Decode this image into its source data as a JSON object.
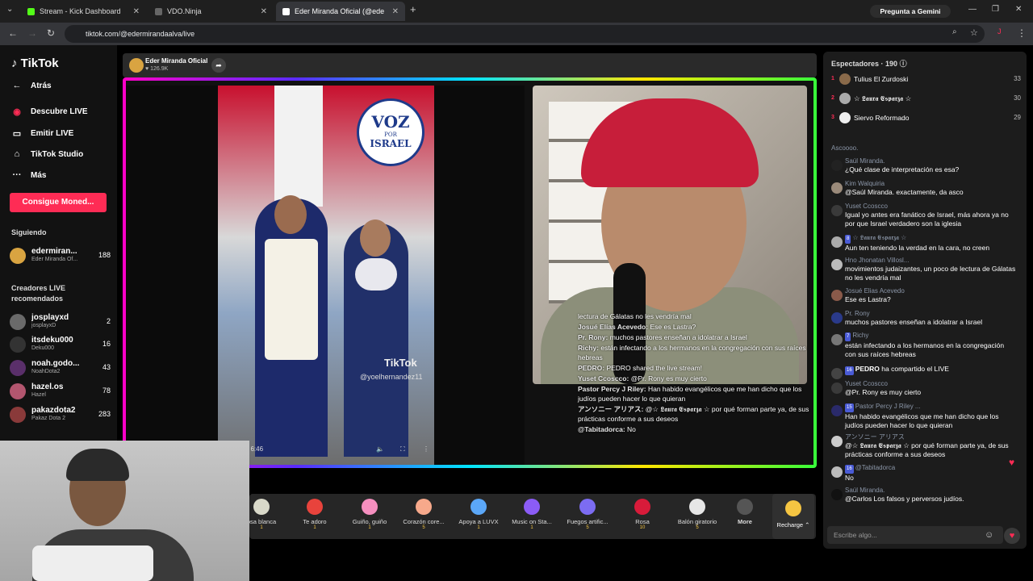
{
  "browser": {
    "tabs": [
      {
        "label": "Stream - Kick Dashboard",
        "color": "#53fc18"
      },
      {
        "label": "VDO.Ninja",
        "color": "#666666"
      },
      {
        "label": "Eder Miranda Oficial (@ede",
        "color": "#111111"
      }
    ],
    "url": "tiktok.com/@edermirandaalva/live",
    "gemini": "Pregunta a Gemini",
    "profile_initial": "J"
  },
  "sidebar": {
    "logo": "TikTok",
    "back": "Atrás",
    "nav": [
      {
        "label": "Descubre LIVE",
        "icon": "live-icon"
      },
      {
        "label": "Emitir LIVE",
        "icon": "camera-icon"
      },
      {
        "label": "TikTok Studio",
        "icon": "home-icon"
      },
      {
        "label": "Más",
        "icon": "more-icon"
      }
    ],
    "coins_button": "Consigue Moned...",
    "following_title": "Siguiendo",
    "following": [
      {
        "name": "edermiran...",
        "sub": "Eder Miranda Of...",
        "count": "188"
      }
    ],
    "recommended_title_1": "Creadores LIVE",
    "recommended_title_2": "recomendados",
    "recommended": [
      {
        "name": "josplayxd",
        "sub": "josplayxD",
        "count": "2"
      },
      {
        "name": "itsdeku000",
        "sub": "Deku000",
        "count": "16"
      },
      {
        "name": "noah.godo...",
        "sub": "NoahDota2",
        "count": "43"
      },
      {
        "name": "hazel.os",
        "sub": "Hazel",
        "count": "78"
      },
      {
        "name": "pakazdota2",
        "sub": "Pakaz Dota 2",
        "count": "283"
      }
    ]
  },
  "host": {
    "name": "Eder Miranda Oficial",
    "likes": "126.9K"
  },
  "video": {
    "logo_top": "VOZ",
    "logo_mid": "POR",
    "logo_bottom": "ISRAEL",
    "watermark": "TikTok",
    "watermark_user": "@yoelhernandez11",
    "time": "/ 6:46"
  },
  "overlay_chat": [
    {
      "user": "",
      "text": "lectura de Gálatas no les vendría mal"
    },
    {
      "user": "Josué Elías Acevedo:",
      "text": "Ese es Lastra?"
    },
    {
      "user": "Pr. Rony:",
      "text": "muchos pastores enseñan a idolatrar a Israel"
    },
    {
      "user": "Richy:",
      "text": "están infectando a los hermanos en la congregación con sus raíces hebreas"
    },
    {
      "user": "PEDRO:",
      "text": "PEDRO shared the live stream!"
    },
    {
      "user": "Yuset Ccoscco:",
      "text": "@Pr. Rony es muy cierto"
    },
    {
      "user": "Pastor Percy J Riley:",
      "text": "Han habido evangélicos que me han dicho que los judíos pueden hacer lo que quieran"
    },
    {
      "user": "アンソニー アリアス:",
      "text": "@☆ 𝕷𝖆𝖚𝖗𝖆 𝕰𝖘𝖕𝖆𝖗𝖟𝖆 ☆ por qué forman parte ya, de sus prácticas conforme a sus deseos"
    },
    {
      "user": "@Tabitadorca:",
      "text": "No"
    }
  ],
  "gifts": [
    {
      "label": "osa blanca",
      "price": "1",
      "color": "#d9d9c9"
    },
    {
      "label": "Te adoro",
      "price": "1",
      "color": "#e8433c"
    },
    {
      "label": "Guiño, guiño",
      "price": "1",
      "color": "#f58fbf"
    },
    {
      "label": "Corazón core...",
      "price": "5",
      "color": "#f7a98b"
    },
    {
      "label": "Apoya a LUVX",
      "price": "1",
      "color": "#5ba7f7"
    },
    {
      "label": "Music on Sta...",
      "price": "1",
      "color": "#8b5cf6"
    },
    {
      "label": "Fuegos artific...",
      "price": "5",
      "color": "#7c6cf2"
    },
    {
      "label": "Rosa",
      "price": "10",
      "color": "#d81b3a"
    },
    {
      "label": "Balón giratorio",
      "price": "5",
      "color": "#e6e6e6"
    },
    {
      "label": "More",
      "price": "",
      "color": "#555555"
    }
  ],
  "recharge": "Recharge",
  "chat": {
    "viewers_title": "Espectadores · 190",
    "top_viewers": [
      {
        "rank": "1",
        "name": "Tulius El Zurdoski",
        "score": "33"
      },
      {
        "rank": "2",
        "name": "☆ 𝕷𝖆𝖚𝖗𝖆 𝕰𝖘𝖕𝖆𝖗𝖟𝖆 ☆",
        "score": "30"
      },
      {
        "rank": "3",
        "name": "Siervo Reformado",
        "score": "29"
      }
    ],
    "messages": [
      {
        "user": "Ascoooo.",
        "text": ""
      },
      {
        "user": "Saúl Miranda.",
        "text": "¿Qué clase de interpretación es esa?"
      },
      {
        "user": "Kim Walquiria",
        "text": "@Saúl Miranda. exactamente, da asco"
      },
      {
        "user": "Yuset Ccoscco",
        "text": "Igual yo antes era fanático de Israel, más ahora ya no por que Israel verdadero son la iglesia"
      },
      {
        "user": "☆ 𝕷𝖆𝖚𝖗𝖆 𝕰𝖘𝖕𝖆𝖗𝖟𝖆 ☆",
        "text": "Aun ten teniendo la verdad en la cara, no creen"
      },
      {
        "user": "Hno Jhonatan Villosl...",
        "text": "movimientos judaizantes, un poco de lectura de Gálatas no les vendría mal"
      },
      {
        "user": "Josué Elias Acevedo",
        "text": "Ese es Lastra?"
      },
      {
        "user": "Pr. Rony",
        "text": "muchos pastores enseñan a idolatrar a Israel"
      },
      {
        "user": "Richy",
        "text": "están infectando a los hermanos en la congregación con sus raíces hebreas"
      },
      {
        "user": "PEDRO",
        "text": "ha compartido el LIVE"
      },
      {
        "user": "Yuset Ccoscco",
        "text": "@Pr. Rony es muy cierto"
      },
      {
        "user": "Pastor Percy J Riley ...",
        "text": "Han habido evangélicos que me han dicho que los judíos pueden hacer lo que quieran"
      },
      {
        "user": "アンソニー アリアス",
        "text": "@☆ 𝕷𝖆𝖚𝖗𝖆 𝕰𝖘𝖕𝖆𝖗𝖟𝖆 ☆ por qué forman parte ya, de sus prácticas conforme a sus deseos"
      },
      {
        "user": "@Tabitadorca",
        "text": "No"
      },
      {
        "user": "Saúl Miranda.",
        "text": "@Carlos Los falsos y perversos judíos."
      }
    ],
    "input_placeholder": "Escribe algo..."
  },
  "colors": {
    "accent": "#fe2c55",
    "bg": "#121212"
  }
}
